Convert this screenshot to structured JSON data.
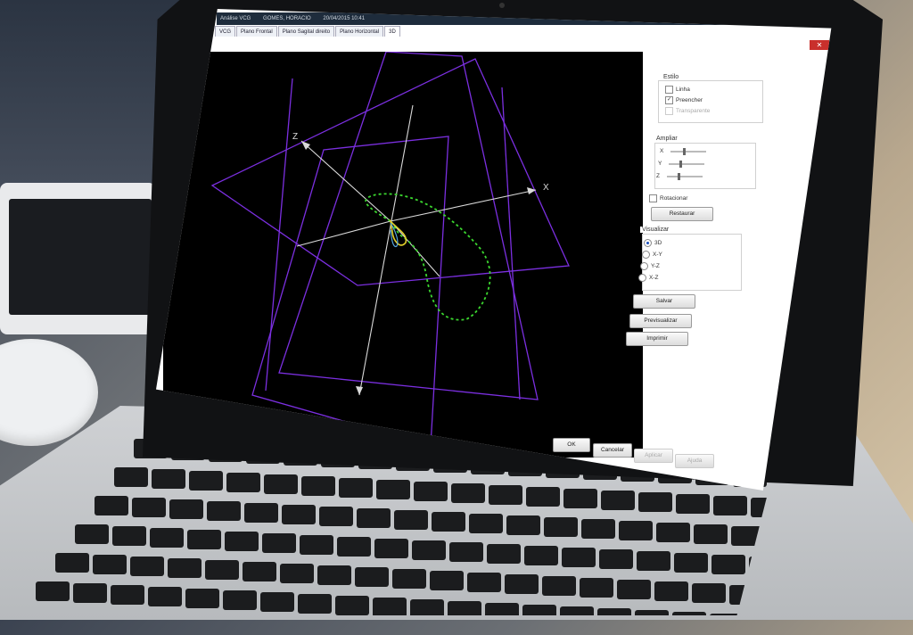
{
  "window": {
    "title_parts": [
      "Análise VCG",
      "GOMES, HORACIO",
      "20/04/2015 10:41"
    ],
    "close_glyph": "✕"
  },
  "tabs": [
    "VCG",
    "Plano Frontal",
    "Plano Sagital direito",
    "Plano Horizontal",
    "3D"
  ],
  "active_tab": 4,
  "view3d": {
    "axis_labels": {
      "x": "X",
      "z": "Z"
    },
    "colors": {
      "plane": "#7b2fe0",
      "axis": "#d9d9d9",
      "loop_green": "#3bd62f",
      "loop_yellow": "#e3d02a"
    }
  },
  "panel": {
    "estilo": {
      "label": "Estilo",
      "items": [
        {
          "label": "Linha",
          "checked": false,
          "enabled": true
        },
        {
          "label": "Preencher",
          "checked": true,
          "enabled": true
        },
        {
          "label": "Transparente",
          "checked": false,
          "enabled": false
        }
      ]
    },
    "ampliar": {
      "label": "Ampliar",
      "sliders": [
        {
          "axis": "X",
          "value": 0.35
        },
        {
          "axis": "Y",
          "value": 0.3
        },
        {
          "axis": "Z",
          "value": 0.3
        }
      ]
    },
    "rotacionar_label": "Rotacionar",
    "restaurar_label": "Restaurar",
    "visualizar": {
      "label": "Visualizar",
      "options": [
        {
          "label": "3D",
          "selected": true
        },
        {
          "label": "X-Y",
          "selected": false
        },
        {
          "label": "Y-Z",
          "selected": false
        },
        {
          "label": "X-Z",
          "selected": false
        }
      ]
    },
    "buttons": {
      "salvar": "Salvar",
      "previsualizar": "Previsualizar",
      "imprimir": "Imprimir"
    }
  },
  "footer": {
    "ok": "OK",
    "cancelar": "Cancelar",
    "aplicar": "Aplicar",
    "ajuda": "Ajuda"
  }
}
